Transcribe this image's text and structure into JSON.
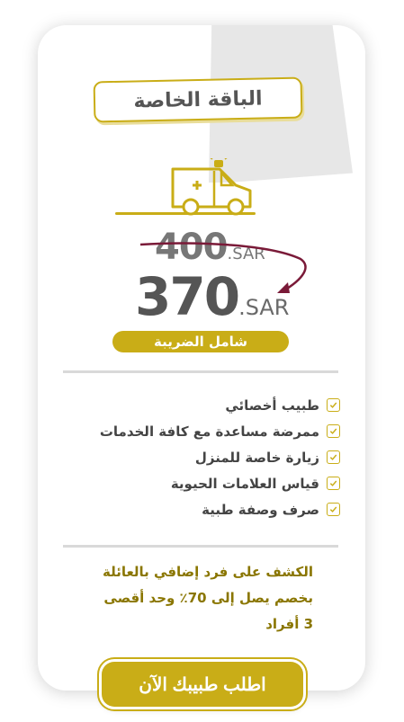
{
  "package": {
    "title": "الباقة الخاصة",
    "icon": "ambulance-icon",
    "old_price": {
      "amount": "400",
      "currency": ".SAR"
    },
    "new_price": {
      "amount": "370",
      "currency": ".SAR"
    },
    "tax_label": "شامل الضريبة"
  },
  "features": [
    {
      "label": "طبيب أخصائي",
      "icon": "check-icon"
    },
    {
      "label": "ممرضة مساعدة مع كافة الخدمات",
      "icon": "check-icon"
    },
    {
      "label": "زيارة خاصة للمنزل",
      "icon": "check-icon"
    },
    {
      "label": "قياس العلامات الحيوية",
      "icon": "check-icon"
    },
    {
      "label": "صرف وصفة طبية",
      "icon": "check-icon"
    }
  ],
  "note": {
    "line1": "الكشف على فرد إضافي بالعائلة",
    "line2": "بخصم يصل إلى 70٪ وحد أقصى",
    "line3": "3 أفراد"
  },
  "cta": {
    "label": "اطلب طبيبك الآن"
  },
  "colors": {
    "accent": "#c9ad17",
    "strike": "#7a1a38",
    "text": "#555555"
  }
}
